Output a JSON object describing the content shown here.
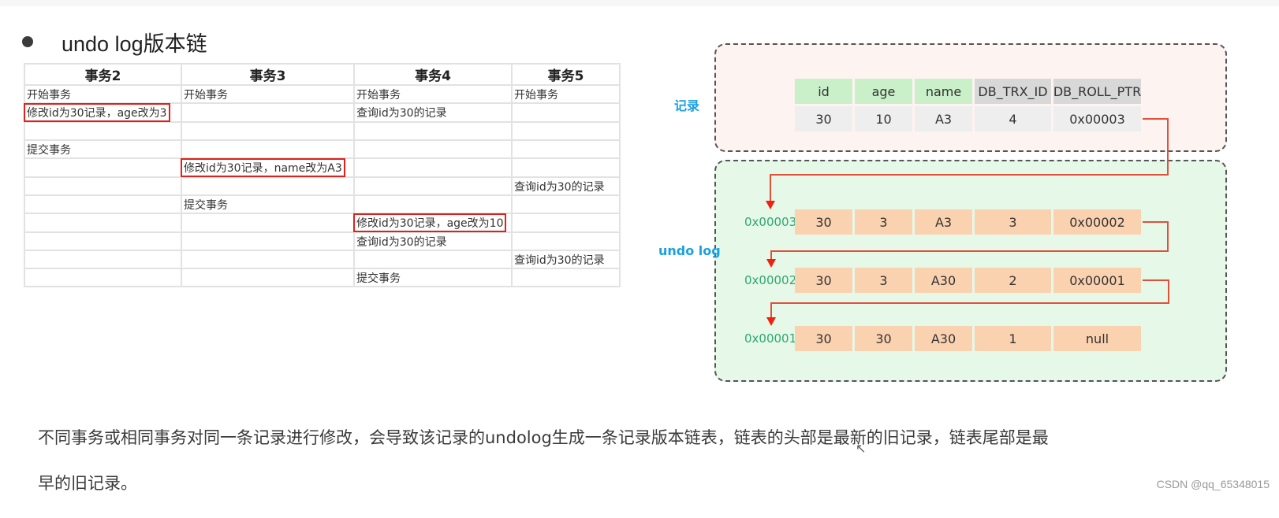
{
  "title": "undo log版本链",
  "transactions": {
    "headers": [
      "事务2",
      "事务3",
      "事务4",
      "事务5"
    ],
    "rows": [
      [
        "开始事务",
        "开始事务",
        "开始事务",
        "开始事务"
      ],
      [
        "修改id为30记录，age改为3",
        "",
        "查询id为30的记录",
        ""
      ],
      [
        "",
        "",
        "",
        ""
      ],
      [
        "提交事务",
        "",
        "",
        ""
      ],
      [
        "",
        "修改id为30记录，name改为A3",
        "",
        ""
      ],
      [
        "",
        "",
        "",
        "查询id为30的记录"
      ],
      [
        "",
        "提交事务",
        "",
        ""
      ],
      [
        "",
        "",
        "修改id为30记录，age改为10",
        ""
      ],
      [
        "",
        "",
        "查询id为30的记录",
        ""
      ],
      [
        "",
        "",
        "",
        "查询id为30的记录"
      ],
      [
        "",
        "",
        "提交事务",
        ""
      ]
    ],
    "highlighted": [
      [
        1,
        0
      ],
      [
        4,
        1
      ],
      [
        7,
        2
      ]
    ],
    "highlight_color": "#e0201b"
  },
  "diagram": {
    "record_label": "记录",
    "undo_label": "undo log",
    "columns": [
      "id",
      "age",
      "name",
      "DB_TRX_ID",
      "DB_ROLL_PTR"
    ],
    "record": [
      "30",
      "10",
      "A3",
      "4",
      "0x00003"
    ],
    "undo_rows": [
      {
        "addr": "0x00003",
        "values": [
          "30",
          "3",
          "A3",
          "3",
          "0x00002"
        ]
      },
      {
        "addr": "0x00002",
        "values": [
          "30",
          "3",
          "A30",
          "2",
          "0x00001"
        ]
      },
      {
        "addr": "0x00001",
        "values": [
          "30",
          "30",
          "A30",
          "1",
          "null"
        ]
      }
    ],
    "colors": {
      "label": "#1aa0e0",
      "addr": "#2fa770",
      "arrow": "#e0503a",
      "record_bg": "#fdf3f1",
      "undo_bg": "#e6f8e8",
      "header_green": "#c9f0c9",
      "header_gray": "#d8d8d8",
      "undo_cell": "#fbd2b0"
    }
  },
  "description": {
    "line1": "不同事务或相同事务对同一条记录进行修改，会导致该记录的undolog生成一条记录版本链表，链表的头部是最新的旧记录，链表尾部是最",
    "line2": "早的旧记录。"
  },
  "watermark": "CSDN @qq_65348015"
}
